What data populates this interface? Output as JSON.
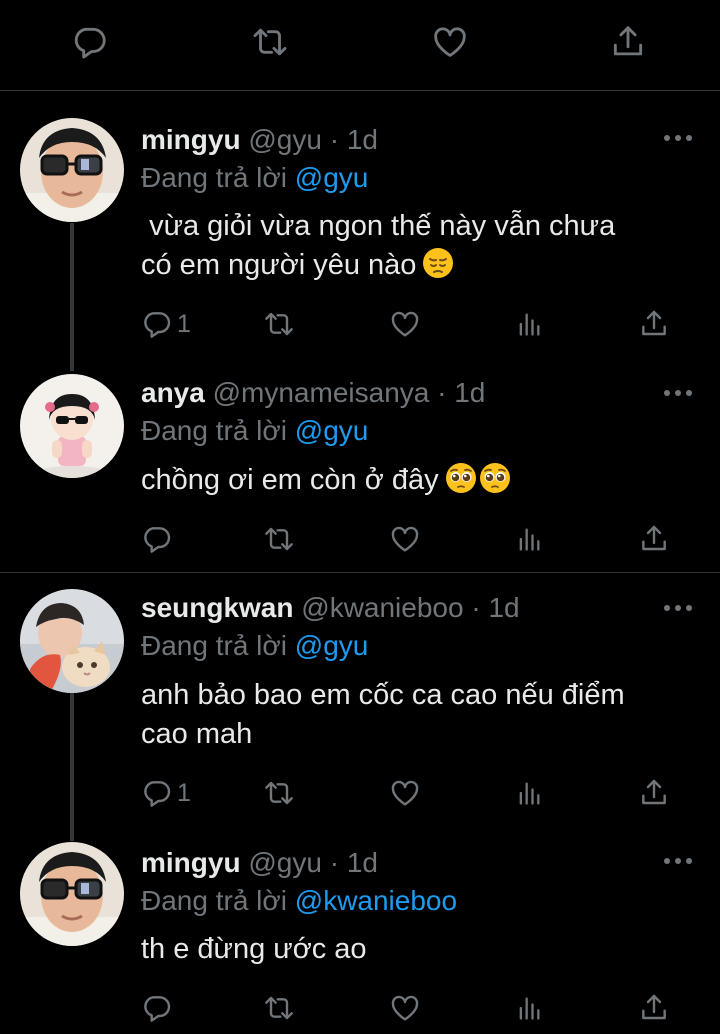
{
  "top_actions": [
    "reply",
    "retweet",
    "like",
    "share"
  ],
  "replies": [
    {
      "name": "mingyu",
      "handle": "@gyu",
      "time": "1d",
      "replying_label": "Đang trả lời",
      "replying_to": "@gyu",
      "text_lines": [
        "vừa giỏi vừa ngon thế này vẫn chưa",
        "có em người yêu nào"
      ],
      "emoji": "pensive-face",
      "reply_count": "1"
    },
    {
      "name": "anya",
      "handle": "@mynameisanya",
      "time": "1d",
      "replying_label": "Đang trả lời",
      "replying_to": "@gyu",
      "text_lines": [
        "chồng ơi em còn ở đây"
      ],
      "emoji": "pleading-face",
      "reply_count": ""
    },
    {
      "name": "seungkwan",
      "handle": "@kwanieboo",
      "time": "1d",
      "replying_label": "Đang trả lời",
      "replying_to": "@gyu",
      "text_lines": [
        "anh bảo bao em cốc ca cao nếu điểm",
        "cao mah"
      ],
      "reply_count": "1"
    },
    {
      "name": "mingyu",
      "handle": "@gyu",
      "time": "1d",
      "replying_label": "Đang trả lời",
      "replying_to": "@kwanieboo",
      "text_lines": [
        "th e đừng ước ao"
      ],
      "reply_count": ""
    }
  ],
  "dot": "·",
  "colors": {
    "background": "#000000",
    "text": "#e7e9ea",
    "muted": "#71767b",
    "link": "#1d9bf0"
  }
}
